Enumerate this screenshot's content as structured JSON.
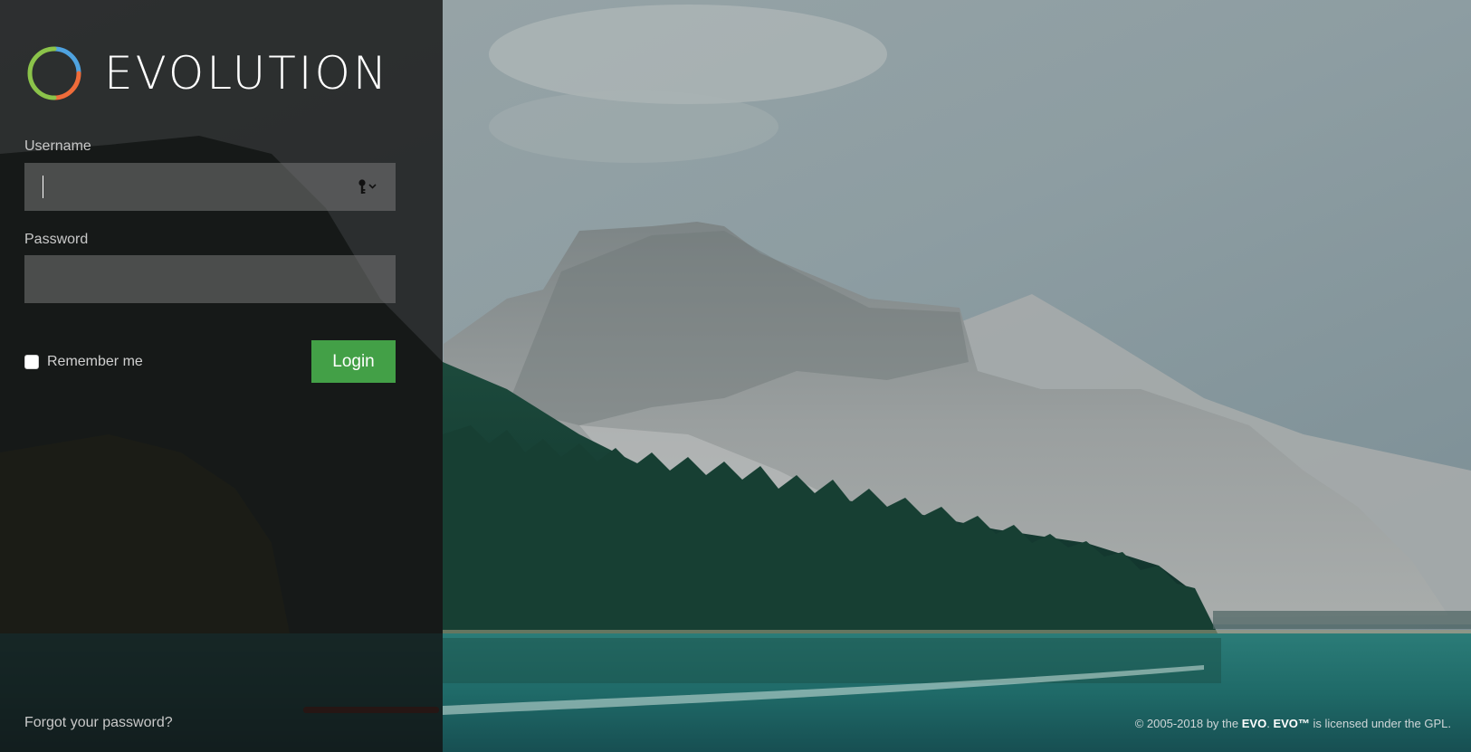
{
  "brand": {
    "name": "EVOLUTION",
    "logo_icon": "evolution-ring-logo",
    "logo_colors": [
      "#8bc34a",
      "#4fa3e0",
      "#ef6c3a"
    ]
  },
  "login_form": {
    "username_label": "Username",
    "username_value": "",
    "username_icon": "key-dropdown-icon",
    "password_label": "Password",
    "password_value": "",
    "remember_label": "Remember me",
    "remember_checked": false,
    "login_label": "Login",
    "login_color": "#43a047"
  },
  "links": {
    "forgot_password": "Forgot your password?"
  },
  "footer": {
    "prefix": "© 2005-2018 by the ",
    "evo_link": "EVO",
    "separator": ". ",
    "evo_tm": "EVO™",
    "suffix": " is licensed under the GPL."
  },
  "colors": {
    "panel_bg": "rgba(18,18,18,0.80)",
    "input_bg": "rgba(120,120,120,0.55)",
    "sky": "#8a999e",
    "lake": "#1f6b6b",
    "forest": "#163c30"
  }
}
